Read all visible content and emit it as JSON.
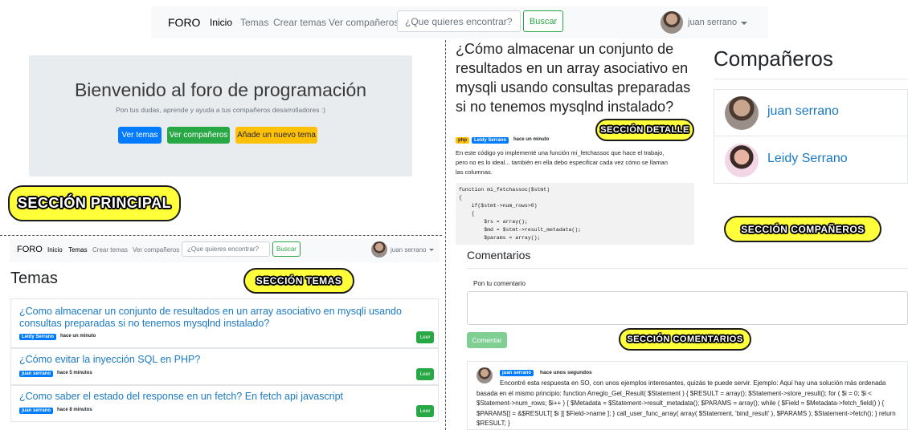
{
  "nav": {
    "brand": "FORO",
    "inicio": "Inicio",
    "temas": "Temas",
    "crear_temas": "Crear temas",
    "ver_companeros": "Ver compañeros",
    "search_placeholder": "¿Que quieres encontrar?",
    "search_button": "Buscar",
    "user": "juan serrano"
  },
  "jumbotron": {
    "title": "Bienvenido al foro de programación",
    "subtitle": "Pon tus dudas, aprende y ayuda a tus compañeros desarrolladores :)",
    "btn_temas": "Ver temas",
    "btn_companeros": "Ver compañeros",
    "btn_nuevo": "Añade un nuevo tema"
  },
  "stickers": {
    "principal": "Sección principal",
    "temas": "Sección temas",
    "detalle": "Sección detalle",
    "companeros": "Sección compañeros",
    "comentarios": "Sección comentarios"
  },
  "temas": {
    "heading": "Temas",
    "leer": "Leer",
    "items": [
      {
        "title": "¿Como almacenar un conjunto de resultados en un array asociativo en mysqli usando consultas preparadas si no tenemos mysqlnd instalado?",
        "author": "Leidy Serrano",
        "time": "hace un minuto"
      },
      {
        "title": "¿Cómo evitar la inyección SQL en PHP?",
        "author": "juan serrano",
        "time": "hace 5 minutos"
      },
      {
        "title": "¿Como saber el estado del response en un fetch? En fetch api javascript",
        "author": "juan serrano",
        "time": "hace 8 minutos"
      }
    ]
  },
  "detalle": {
    "title": "¿Cómo almacenar un conjunto de resultados en un array asociativo en mysqli usando consultas preparadas si no tenemos mysqlnd instalado?",
    "tag": "php",
    "author": "Leidy Serrano",
    "time": "hace un minuto",
    "body": "En este código yo implementé una función mi_fetchassoc que hace el trabajo, pero no es lo ideal... también en ella debo especificar cada vez cómo se llaman las columnas.",
    "code": "function mi_fetchassoc($stmt)\n{\n    if($stmt->num_rows>0)\n    {\n        $rs = array();\n        $md = $stmt->result_metadata();\n        $params = array();"
  },
  "comentarios": {
    "heading": "Comentarios",
    "label": "Pon tu comentario",
    "button": "Comentar",
    "comment_author": "juan serrano",
    "comment_time": "hace unos segundos",
    "comment_text": "Encontré esta respuesta en SO, con unos ejemplos interesantes, quizás te puede servir. Ejemplo: Aquí hay una solución más ordenada basada en el mismo principio: function Arreglo_Get_Result( $Statement ) { $RESULT = array(); $Statement->store_result(); for ( $i = 0; $i < $Statement->num_rows; $i++ ) { $Metadata = $Statement->result_metadata(); $PARAMS = array(); while ( $Field = $Metadata->fetch_field() ) { $PARAMS[] = &$RESULT[ $i ][ $Field->name ]; } call_user_func_array( array( $Statement, 'bind_result' ), $PARAMS ); $Statement->fetch(); } return $RESULT; }"
  },
  "companeros": {
    "heading": "Compañeros",
    "items": [
      "juan serrano",
      "Leidy Serrano"
    ]
  },
  "colors": {
    "primary": "#007bff",
    "success": "#28a745",
    "warning": "#ffc107",
    "sticker": "#ffff3a",
    "link": "#1a79c4"
  }
}
